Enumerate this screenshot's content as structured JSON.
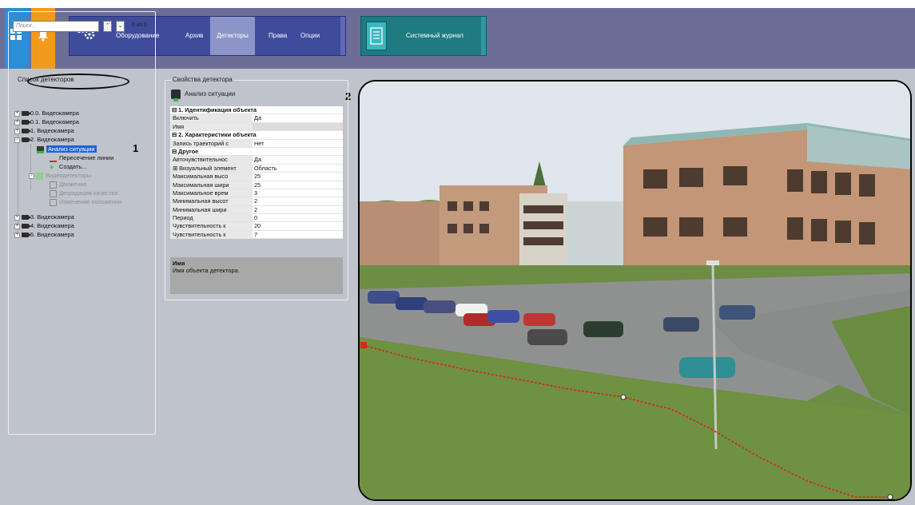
{
  "toolbar": {
    "nav_items": [
      "Оборудование",
      "Архив",
      "Детекторы",
      "Права",
      "Опции"
    ],
    "active_nav": "Детекторы",
    "journal_label": "Системный журнал"
  },
  "detectors_list": {
    "title": "Список детекторов",
    "search_placeholder": "Поиск...",
    "counter": "0 из 0",
    "tree": [
      {
        "label": "0.0. Видеокамера"
      },
      {
        "label": "0.1. Видеокамера"
      },
      {
        "label": "1. Видеокамера"
      },
      {
        "label": "2. Видеокамера"
      },
      {
        "label": "Анализ ситуации",
        "selected": true
      },
      {
        "label": "Пересечение линии"
      },
      {
        "label": "Создать..."
      },
      {
        "label": "Видеодетекторы",
        "disabled": true
      },
      {
        "label": "Движение",
        "disabled": true
      },
      {
        "label": "Деградация качества",
        "disabled": true
      },
      {
        "label": "Изменение положения",
        "disabled": true
      },
      {
        "label": "3. Видеокамера"
      },
      {
        "label": "4. Видеокамера"
      },
      {
        "label": "5. Видеокамера"
      }
    ]
  },
  "callouts": {
    "one": "1",
    "two": "2"
  },
  "properties": {
    "title": "Свойства детектора",
    "header": "Анализ ситуации",
    "rows": [
      {
        "group": "⊟ 1. Идентификация объекта"
      },
      {
        "key": "Включить",
        "value": "Да"
      },
      {
        "key": "Имя",
        "value": ""
      },
      {
        "group": "⊟ 2. Характеристики объекта"
      },
      {
        "key": "Запись траекторий с",
        "value": "Нет"
      },
      {
        "group": "⊟ Другое"
      },
      {
        "key": "Авточувствительнос",
        "value": "Да"
      },
      {
        "key": "⊞ Визуальный элемент",
        "value": "Область"
      },
      {
        "key": "Максимальная высо",
        "value": "25"
      },
      {
        "key": "Максимальная шири",
        "value": "25"
      },
      {
        "key": "Максимальное врем",
        "value": "3"
      },
      {
        "key": "Минимальная высот",
        "value": "2"
      },
      {
        "key": "Минимальная шири",
        "value": "2"
      },
      {
        "key": "Период",
        "value": "0"
      },
      {
        "key": "Чувствительность к",
        "value": "20"
      },
      {
        "key": "Чувствительность к",
        "value": "7"
      }
    ],
    "description_title": "Имя",
    "description_text": "Имя объекта детектора."
  },
  "colors": {
    "toolbar_bg": "#6d6e97",
    "nav_bg": "#3f4c9c",
    "nav_active": "#8d95c8",
    "journal_bg": "#1f7a82",
    "selection": "#1d64d8",
    "zone_line": "#d8261c"
  }
}
